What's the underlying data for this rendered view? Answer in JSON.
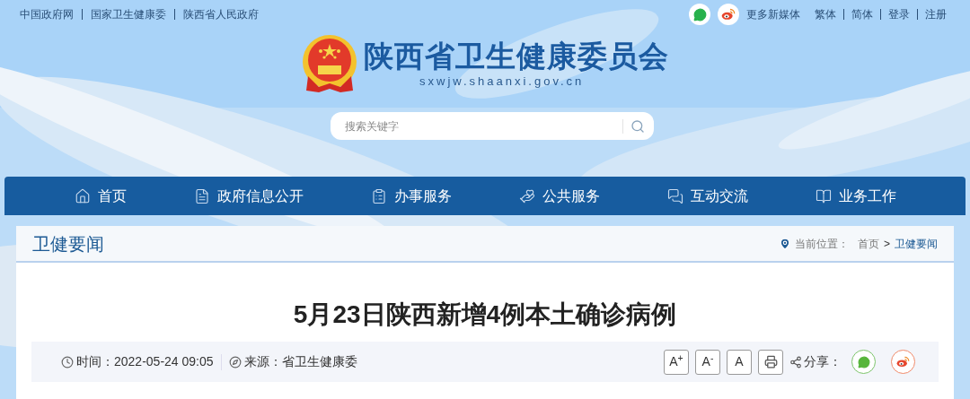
{
  "top_links": [
    "中国政府网",
    "国家卫生健康委",
    "陕西省人民政府"
  ],
  "top_right": {
    "media_label": "更多新媒体",
    "links": [
      "繁体",
      "简体",
      "登录",
      "注册"
    ]
  },
  "site": {
    "title": "陕西省卫生健康委员会",
    "domain": "sxwjw.shaanxi.gov.cn"
  },
  "search": {
    "placeholder": "搜索关键字"
  },
  "nav": [
    {
      "label": "首页"
    },
    {
      "label": "政府信息公开"
    },
    {
      "label": "办事服务"
    },
    {
      "label": "公共服务"
    },
    {
      "label": "互动交流"
    },
    {
      "label": "业务工作"
    }
  ],
  "section": {
    "title": "卫健要闻",
    "location_label": "当前位置：",
    "breadcrumb": [
      "首页",
      "卫健要闻"
    ],
    "separator": ">"
  },
  "article": {
    "title": "5月23日陕西新增4例本土确诊病例",
    "time_label": "时间：",
    "time": "2022-05-24 09:05",
    "source_label": "来源：",
    "source": "省卫生健康委",
    "font_buttons": [
      "A$^{+}$",
      "A$^{-}$",
      "A"
    ],
    "share_label": "分享："
  }
}
